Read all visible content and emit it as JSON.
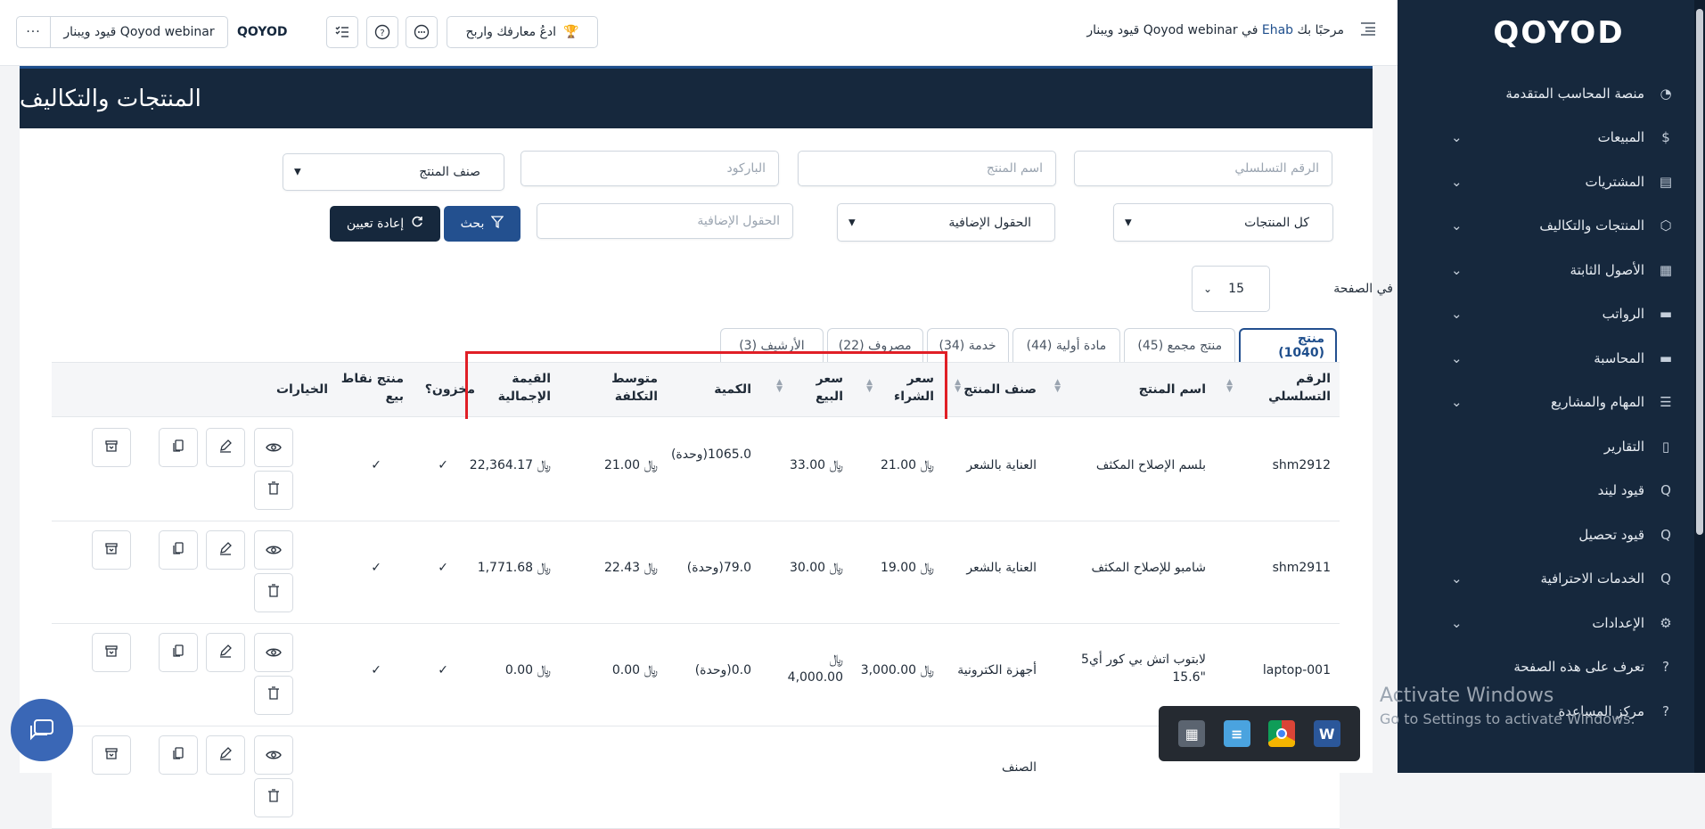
{
  "sidebar": {
    "logo": "QOYOD",
    "items": [
      {
        "label": "منصة المحاسب المتقدمة",
        "icon": "dashboard-icon",
        "chevron": false
      },
      {
        "label": "المبيعات",
        "icon": "dollar-icon",
        "chevron": true
      },
      {
        "label": "المشتريات",
        "icon": "clipboard-icon",
        "chevron": true
      },
      {
        "label": "المنتجات والتكاليف",
        "icon": "box-icon",
        "chevron": true
      },
      {
        "label": "الأصول الثابتة",
        "icon": "grid-icon",
        "chevron": true
      },
      {
        "label": "الرواتب",
        "icon": "folder-icon",
        "chevron": true
      },
      {
        "label": "المحاسبة",
        "icon": "folder-icon",
        "chevron": true
      },
      {
        "label": "المهام والمشاريع",
        "icon": "tasks-icon",
        "chevron": true
      },
      {
        "label": "التقارير",
        "icon": "report-icon",
        "chevron": false
      },
      {
        "label": "قيود ليند",
        "icon": "q-icon",
        "chevron": false
      },
      {
        "label": "قيود تحصيل",
        "icon": "q-icon",
        "chevron": false
      },
      {
        "label": "الخدمات الاحترافية",
        "icon": "q-icon",
        "chevron": true
      },
      {
        "label": "الإعدادات",
        "icon": "gear-icon",
        "chevron": true
      },
      {
        "label": "تعرف على هذه الصفحة",
        "icon": "help-icon",
        "chevron": false
      },
      {
        "label": "مركز المساعدة",
        "icon": "help-icon",
        "chevron": false
      }
    ]
  },
  "topbar": {
    "welcome_prefix": "مرحبًا بك",
    "user": "Ehab",
    "welcome_suffix": "في Qoyod webinar قيود ويبنار",
    "invite_label": "ادعُ معارفك واربح",
    "company_name": "Qoyod webinar قيود ويبنار",
    "more": "···",
    "mini_logo": "QOYOD"
  },
  "page": {
    "title": "المنتجات والتكاليف"
  },
  "filters": {
    "serial_placeholder": "الرقم التسلسلي",
    "name_placeholder": "اسم المنتج",
    "barcode_placeholder": "الباركود",
    "category_select": "صنف المنتج",
    "all_products_select": "كل المنتجات",
    "extra_fields_select": "الحقول الإضافية",
    "extra_fields_placeholder": "الحقول الإضافية",
    "search_label": "بحث",
    "reset_label": "إعادة تعيين"
  },
  "pagination": {
    "per_page_label": "في الصفحة",
    "per_page_value": "15"
  },
  "tabs": [
    {
      "label": "منتج (1040)",
      "active": true
    },
    {
      "label": "منتج مجمع (45)",
      "active": false
    },
    {
      "label": "مادة أولية (44)",
      "active": false
    },
    {
      "label": "خدمة (34)",
      "active": false
    },
    {
      "label": "مصروف (22)",
      "active": false
    },
    {
      "label": "الأرشيف (3)",
      "active": false
    }
  ],
  "table": {
    "headers": {
      "serial": "الرقم التسلسلي",
      "name": "اسم المنتج",
      "category": "صنف المنتج",
      "buy_price": "سعر الشراء",
      "sell_price": "سعر البيع",
      "quantity": "الكمية",
      "avg_cost": "متوسط التكلفة",
      "total_value": "القيمة الإجمالية",
      "stocked": "مخزون؟",
      "pos_product": "منتج نقاط بيع",
      "options": "الخيارات"
    },
    "currency": "﷼",
    "rows": [
      {
        "serial": "shm2912",
        "name": "بلسم الإصلاح المكثف",
        "category": "العناية بالشعر",
        "buy_price": "21.00",
        "sell_price": "33.00",
        "quantity": "1065.0(وحدة)",
        "avg_cost": "21.00",
        "total_value": "22,364.17",
        "stocked": "✓",
        "pos": "✓"
      },
      {
        "serial": "shm2911",
        "name": "شامبو للإصلاح المكثف",
        "category": "العناية بالشعر",
        "buy_price": "19.00",
        "sell_price": "30.00",
        "quantity": "79.0(وحدة)",
        "avg_cost": "22.43",
        "total_value": "1,771.68",
        "stocked": "✓",
        "pos": "✓"
      },
      {
        "serial": "laptop-001",
        "name": "لابتوب اتش بي كور أي5 \"15.6",
        "category": "أجهزة الكترونية",
        "buy_price": "3,000.00",
        "sell_price": "4,000.00",
        "quantity": "0.0(وحدة)",
        "avg_cost": "0.00",
        "total_value": "0.00",
        "stocked": "✓",
        "pos": "✓"
      },
      {
        "serial": "",
        "name": "",
        "category": "الصنف",
        "buy_price": "",
        "sell_price": "",
        "quantity": "",
        "avg_cost": "",
        "total_value": "",
        "stocked": "",
        "pos": ""
      }
    ]
  },
  "overlay": {
    "activate_title": "Activate Windows",
    "activate_sub": "Go to Settings to activate Windows."
  },
  "colors": {
    "sidebar": "#16283d",
    "primary": "#23508f",
    "highlight": "#e01f26"
  }
}
